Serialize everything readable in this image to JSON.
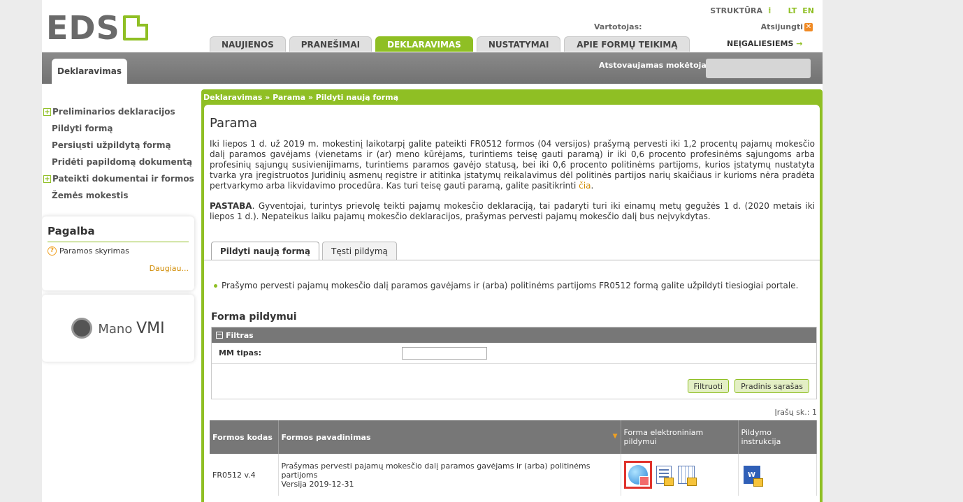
{
  "header": {
    "logo_text": "EDS",
    "structure_label": "STRUKTŪRA",
    "lang_lt": "LT",
    "lang_en": "EN",
    "user_label": "Vartotojas:",
    "logout_label": "Atsijungti",
    "tabs": [
      "NAUJIENOS",
      "PRANEŠIMAI",
      "DEKLARAVIMAS",
      "NUSTATYMAI",
      "APIE FORMŲ TEIKIMĄ"
    ],
    "active_tab": "DEKLARAVIMAS",
    "accessibility_label": "NEĮGALIESIEMS",
    "section_tab": "Deklaravimas",
    "payer_label": "Atstovaujamas mokėtojas:"
  },
  "sidebar": {
    "items": [
      {
        "label": "Preliminarios deklaracijos",
        "expandable": true
      },
      {
        "label": "Pildyti formą",
        "expandable": false
      },
      {
        "label": "Persiųsti užpildytą formą",
        "expandable": false
      },
      {
        "label": "Pridėti papildomą dokumentą",
        "expandable": false
      },
      {
        "label": "Pateikti dokumentai ir formos",
        "expandable": true
      },
      {
        "label": "Žemės mokestis",
        "expandable": false
      }
    ],
    "help": {
      "title": "Pagalba",
      "link": "Paramos skyrimas",
      "more": "Daugiau..."
    },
    "vmi": {
      "prefix": "Mano",
      "suffix": "VMI"
    }
  },
  "main": {
    "breadcrumb": "Deklaravimas » Parama » Pildyti naują formą",
    "title": "Parama",
    "para1": "Iki liepos 1 d. už 2019 m. mokestinį laikotarpį galite pateikti FR0512 formos (04 versijos) prašymą pervesti iki 1,2 procentų pajamų mokesčio dalį paramos gavėjams (vienetams ir (ar) meno kūrėjams, turintiems teisę gauti paramą) ir iki 0,6 procento profesinėms sąjungoms arba profesinių sąjungų susivienijimams, turintiems paramos gavėjo statusą, bei iki 0,6 procento politinėms partijoms, kurios įstatymų nustatyta tvarka yra įregistruotos Juridinių asmenų registre ir atitinka įstatymų reikalavimus dėl politinės partijos narių skaičiaus ir kurioms nėra pradėta pertvarkymo arba likvidavimo procedūra. Kas turi teisę gauti paramą, galite pasitikrinti ",
    "para1_link": "čia",
    "para1_end": ".",
    "note_bold": "PASTABA",
    "note_text": ". Gyventojai, turintys prievolę teikti pajamų mokesčio deklaraciją, tai padaryti turi iki einamų metų gegužės 1 d. (2020 metais iki liepos 1 d.). Nepateikus laiku pajamų mokesčio deklaracijos, prašymas pervesti pajamų mokesčio dalį bus neįvykdytas.",
    "form_tabs": [
      "Pildyti naują formą",
      "Tęsti pildymą"
    ],
    "bullet": "Prašymo pervesti pajamų mokesčio dalį paramos gavėjams ir (arba) politinėms partijoms FR0512 formą galite užpildyti tiesiogiai portale.",
    "section_title": "Forma pildymui",
    "filter": {
      "header": "Filtras",
      "mm_label": "MM tipas:",
      "mm_value": "",
      "btn_filter": "Filtruoti",
      "btn_reset": "Pradinis sąrašas"
    },
    "record_count": "Įrašų sk.: 1",
    "table": {
      "headers": [
        "Formos kodas",
        "Formos pavadinimas",
        "Forma elektroniniam pildymui",
        "Pildymo instrukcija"
      ],
      "rows": [
        {
          "code": "FR0512 v.4",
          "name": "Prašymas pervesti pajamų mokesčio dalį paramos gavėjams ir (arba) politinėms partijoms",
          "version": "Versija 2019-12-31"
        }
      ]
    }
  }
}
